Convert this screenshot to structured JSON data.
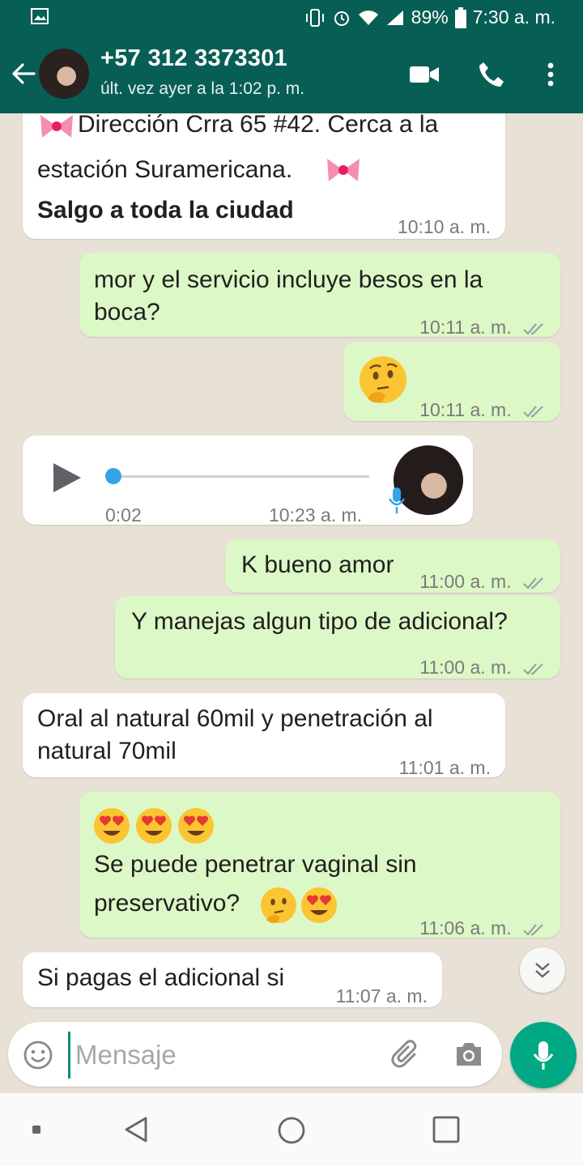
{
  "status_bar": {
    "battery": "89%",
    "time": "7:30 a. m.",
    "icons": [
      "image-icon",
      "vibrate-icon",
      "alarm-icon",
      "wifi-icon",
      "signal-icon",
      "battery-icon"
    ]
  },
  "header": {
    "contact": "+57 312 3373301",
    "last_seen": "últ. vez ayer a la 1:02 p. m.",
    "icons": [
      "back-arrow-icon",
      "video-call-icon",
      "phone-icon",
      "more-vert-icon"
    ],
    "color": "#075e54"
  },
  "messages": [
    {
      "dir": "in",
      "line1": "Dirección Crra 65 #42. Cerca a la",
      "line2": "estación Suramericana.",
      "line3": "Salgo a toda la ciudad",
      "time": "10:10 a. m.",
      "emojis": [
        "ribbon",
        "ribbon"
      ]
    },
    {
      "dir": "out",
      "line1": "mor y el servicio incluye besos en la",
      "line2": "boca?",
      "time": "10:11 a. m."
    },
    {
      "dir": "out",
      "emoji": "thinking-face",
      "time": "10:11 a. m."
    },
    {
      "dir": "in",
      "type": "voice-note",
      "duration": "0:02",
      "progress": 0,
      "time": "10:23 a. m."
    },
    {
      "dir": "out",
      "line1": "K bueno amor",
      "time": "11:00 a. m."
    },
    {
      "dir": "out",
      "line1": "Y manejas algun tipo de adicional?",
      "time": "11:00 a. m."
    },
    {
      "dir": "in",
      "line1": "Oral al natural 60mil y penetración al",
      "line2": "natural 70mil",
      "time": "11:01 a. m."
    },
    {
      "dir": "out",
      "emojis": [
        "heart-eyes",
        "heart-eyes",
        "heart-eyes"
      ],
      "line1": "Se puede penetrar vaginal sin",
      "line2": "preservativo?",
      "emojis2": [
        "thinking-face",
        "heart-eyes"
      ],
      "time": "11:06 a. m."
    },
    {
      "dir": "in",
      "line1": "Si pagas el adicional si",
      "time": "11:07 a. m."
    }
  ],
  "input": {
    "placeholder": "Mensaje",
    "icons": [
      "emoji-icon",
      "attach-icon",
      "camera-icon",
      "mic-icon"
    ]
  },
  "colors": {
    "incoming": "#ffffff",
    "outgoing": "#dcf8c6",
    "accent": "#00a884",
    "wallpaper": "#e8e1d6"
  }
}
